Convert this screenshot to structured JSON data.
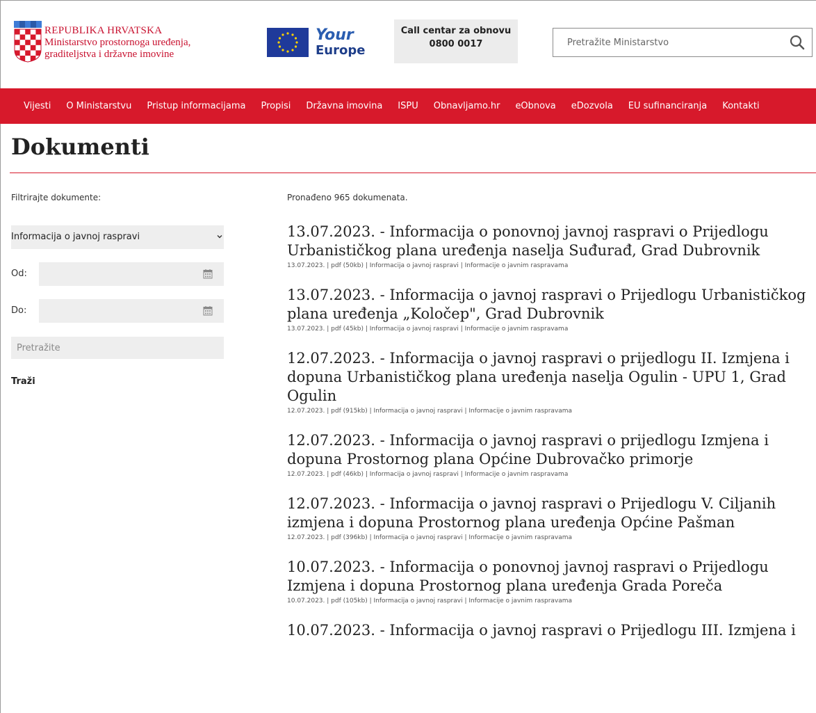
{
  "header": {
    "logo": {
      "line1": "REPUBLIKA HRVATSKA",
      "line2": "Ministarstvo prostornoga uređenja,",
      "line3": "graditeljstva i državne imovine"
    },
    "your_europe": {
      "line1": "Your",
      "line2": "Europe"
    },
    "call_center": {
      "label": "Call centar za obnovu",
      "number": "0800 0017"
    },
    "search": {
      "placeholder": "Pretražite Ministarstvo"
    }
  },
  "nav": {
    "items": [
      "Vijesti",
      "O Ministarstvu",
      "Pristup informacijama",
      "Propisi",
      "Državna imovina",
      "ISPU",
      "Obnavljamo.hr",
      "eObnova",
      "eDozvola",
      "EU sufinanciranja",
      "Kontakti"
    ]
  },
  "page": {
    "title": "Dokumenti"
  },
  "filters": {
    "label": "Filtrirajte dokumente:",
    "type_selected": "Informacija o javnoj raspravi",
    "from_label": "Od:",
    "to_label": "Do:",
    "search_placeholder": "Pretražite",
    "submit_label": "Traži"
  },
  "results": {
    "count_text": "Pronađeno 965 dokumenata.",
    "items": [
      {
        "title": "13.07.2023. - Informacija o ponovnoj javnoj raspravi o Prijedlogu Urbanističkog plana uređenja naselja Suđurađ, Grad Dubrovnik",
        "meta": "13.07.2023. | pdf (50kb) | Informacija o javnoj raspravi | Informacije o javnim raspravama"
      },
      {
        "title": "13.07.2023. - Informacija o javnoj raspravi o Prijedlogu Urbanističkog plana uređenja „Koločep\", Grad Dubrovnik",
        "meta": "13.07.2023. | pdf (45kb) | Informacija o javnoj raspravi | Informacije o javnim raspravama"
      },
      {
        "title": "12.07.2023. - Informacija o javnoj raspravi o prijedlogu II. Izmjena i dopuna Urbanističkog plana uređenja naselja Ogulin - UPU 1, Grad Ogulin",
        "meta": "12.07.2023. | pdf (915kb) | Informacija o javnoj raspravi | Informacije o javnim raspravama"
      },
      {
        "title": "12.07.2023. - Informacija o javnoj raspravi o prijedlogu Izmjena i dopuna Prostornog plana Općine Dubrovačko primorje",
        "meta": "12.07.2023. | pdf (46kb) | Informacija o javnoj raspravi | Informacije o javnim raspravama"
      },
      {
        "title": "12.07.2023. - Informacija o javnoj raspravi o Prijedlogu V. Ciljanih izmjena i dopuna Prostornog plana uređenja Općine Pašman",
        "meta": "12.07.2023. | pdf (396kb) | Informacija o javnoj raspravi | Informacije o javnim raspravama"
      },
      {
        "title": "10.07.2023. - Informacija o ponovnoj javnoj raspravi o Prijedlogu Izmjena i dopuna Prostornog plana uređenja Grada Poreča",
        "meta": "10.07.2023. | pdf (105kb) | Informacija o javnoj raspravi | Informacije o javnim raspravama"
      },
      {
        "title": "10.07.2023. - Informacija o javnoj raspravi o Prijedlogu III. Izmjena i",
        "meta": ""
      }
    ]
  },
  "colors": {
    "brand_red": "#d7192b",
    "logo_red": "#c8102e",
    "field_bg": "#eeeeee"
  }
}
